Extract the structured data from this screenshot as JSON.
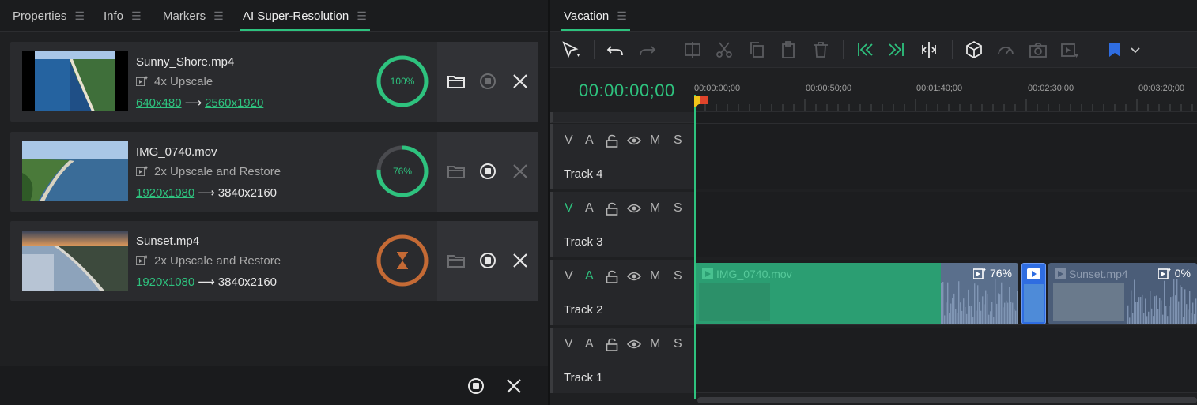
{
  "left_panel": {
    "tabs": [
      {
        "label": "Properties"
      },
      {
        "label": "Info"
      },
      {
        "label": "Markers"
      },
      {
        "label": "AI Super-Resolution",
        "active": true
      }
    ],
    "jobs": [
      {
        "file": "Sunny_Shore.mp4",
        "mode": "4x Upscale",
        "from": "640x480",
        "to": "2560x1920",
        "to_linked": true,
        "progress": 100,
        "label": "100%",
        "state": "done"
      },
      {
        "file": "IMG_0740.mov",
        "mode": "2x Upscale and Restore",
        "from": "1920x1080",
        "to": "3840x2160",
        "to_linked": false,
        "progress": 76,
        "label": "76%",
        "state": "processing"
      },
      {
        "file": "Sunset.mp4",
        "mode": "2x Upscale and Restore",
        "from": "1920x1080",
        "to": "3840x2160",
        "to_linked": false,
        "progress": 0,
        "label": "",
        "state": "queued"
      }
    ]
  },
  "right_panel": {
    "tab": "Vacation",
    "timecode": "00:00:00;00",
    "ruler": [
      "00:00:00;00",
      "00:00:50;00",
      "00:01:40;00",
      "00:02:30;00",
      "00:03:20;00"
    ],
    "tracks": [
      {
        "name": "Track 4",
        "v_on": false,
        "a_on": false
      },
      {
        "name": "Track 3",
        "v_on": true,
        "a_on": false
      },
      {
        "name": "Track 2",
        "v_on": false,
        "a_on": true
      },
      {
        "name": "Track 1",
        "v_on": false,
        "a_on": false
      }
    ],
    "track_controls": {
      "v": "V",
      "a": "A",
      "m": "M",
      "s": "S"
    },
    "clips": [
      {
        "name": "IMG_0740.mov",
        "pct": "76%"
      },
      {
        "name": "Sunset.mp4",
        "pct": "0%"
      }
    ]
  },
  "colors": {
    "accent": "#2ec27e",
    "queued": "#c46a35",
    "clip_green": "#2b9e72",
    "clip_blue": "#4b5d78"
  }
}
